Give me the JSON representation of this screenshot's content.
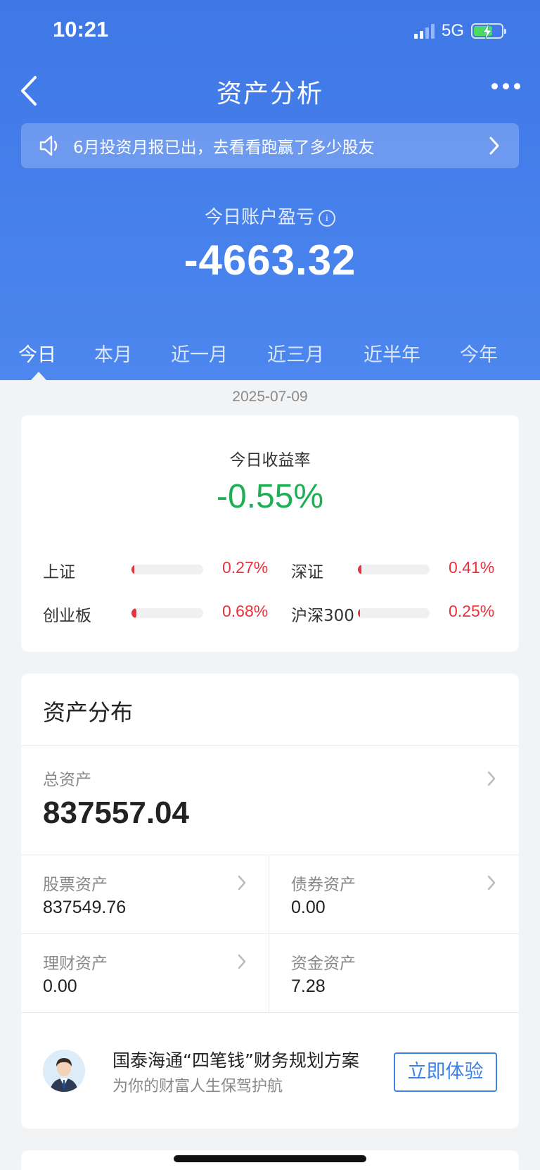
{
  "status_bar": {
    "time": "10:21",
    "network": "5G"
  },
  "nav": {
    "title": "资产分析"
  },
  "notice": {
    "text": "6月投资月报已出，去看看跑赢了多少股友"
  },
  "pnl": {
    "label": "今日账户盈亏",
    "info_icon": "i",
    "value": "-4663.32"
  },
  "tabs": [
    {
      "label": "今日",
      "active": true
    },
    {
      "label": "本月",
      "active": false
    },
    {
      "label": "近一月",
      "active": false
    },
    {
      "label": "近三月",
      "active": false
    },
    {
      "label": "近半年",
      "active": false
    },
    {
      "label": "今年",
      "active": false
    }
  ],
  "date": "2025-07-09",
  "return_rate": {
    "label": "今日收益率",
    "value": "-0.55%",
    "indices": [
      {
        "name": "上证",
        "value": "0.27%",
        "fill_fraction": 0.04
      },
      {
        "name": "深证",
        "value": "0.41%",
        "fill_fraction": 0.05
      },
      {
        "name": "创业板",
        "value": "0.68%",
        "fill_fraction": 0.07
      },
      {
        "name": "沪深300",
        "value": "0.25%",
        "fill_fraction": 0.03
      }
    ]
  },
  "assets": {
    "title": "资产分布",
    "total": {
      "label": "总资产",
      "value": "837557.04"
    },
    "items": [
      {
        "label": "股票资产",
        "value": "837549.76"
      },
      {
        "label": "债券资产",
        "value": "0.00"
      },
      {
        "label": "理财资产",
        "value": "0.00"
      },
      {
        "label": "资金资产",
        "value": "7.28"
      }
    ]
  },
  "promo": {
    "title": "国泰海通“四笔钱”财务规划方案",
    "subtitle": "为你的财富人生保驾护航",
    "button": "立即体验"
  },
  "colors": {
    "brand_blue": "#3f78e6",
    "negative_green": "#1fae55",
    "positive_red": "#e8323c"
  }
}
